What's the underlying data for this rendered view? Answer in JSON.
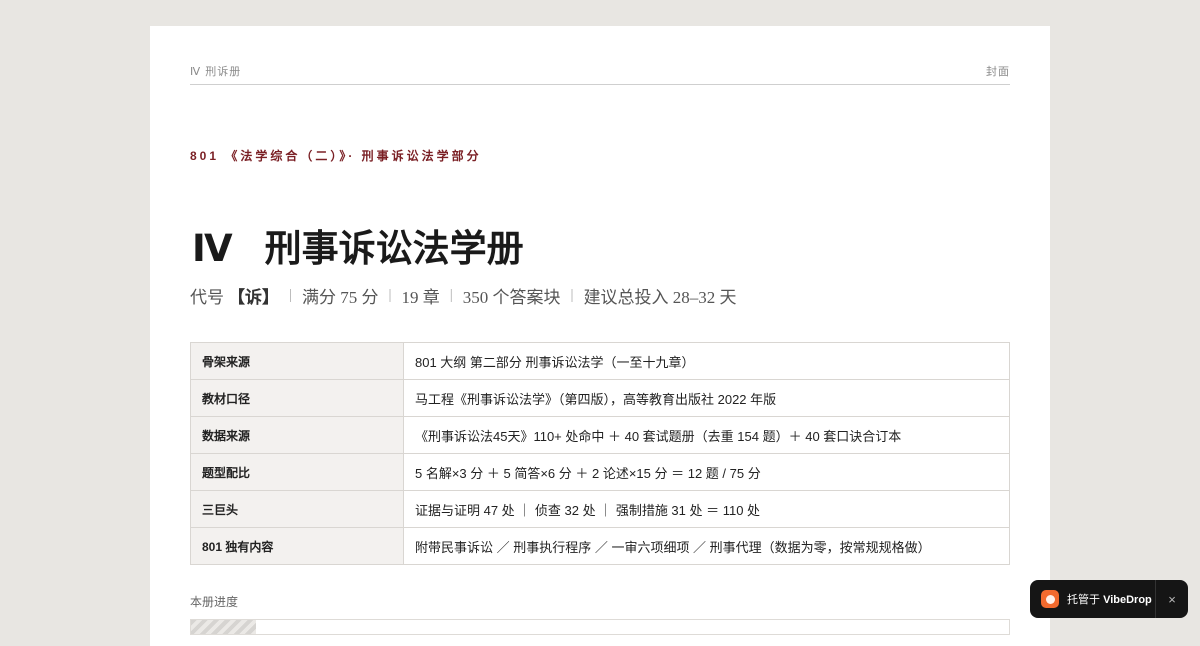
{
  "running_head": {
    "left": "Ⅳ 刑诉册",
    "right": "封面"
  },
  "eyebrow": "801 《法学综合（二）》· 刑事诉讼法学部分",
  "title": {
    "roman": "Ⅳ",
    "name": "刑事诉讼法学册"
  },
  "meta": {
    "code_label": "代号",
    "code_value": "【诉】",
    "separator": "|",
    "items": [
      "满分 75 分",
      "19 章",
      "350 个答案块",
      "建议总投入 28–32 天"
    ]
  },
  "info_table": [
    {
      "key": "骨架来源",
      "value": "801 大纲 第二部分 刑事诉讼法学（一至十九章）"
    },
    {
      "key": "教材口径",
      "value": "马工程《刑事诉讼法学》（第四版），高等教育出版社 2022 年版"
    },
    {
      "key": "数据来源",
      "value": "《刑事诉讼法45天》110+ 处命中 ＋ 40 套试题册（去重 154 题）＋ 40 套口诀合订本"
    },
    {
      "key": "题型配比",
      "value": "5 名解×3 分 ＋ 5 简答×6 分 ＋ 2 论述×15 分 ＝ 12 题 / 75 分"
    },
    {
      "key": "三巨头",
      "value": "证据与证明 47 处 ｜ 侦查 32 处 ｜ 强制措施 31 处 ＝ 110 处"
    },
    {
      "key": "801 独有内容",
      "value": "附带民事诉讼 ／ 刑事执行程序 ／ 一审六项细项 ／ 刑事代理（数据为零，按常规规格做）"
    }
  ],
  "progress": {
    "label": "本册进度",
    "fraction": 0.08
  },
  "toast": {
    "prefix": "托管于",
    "brand": "VibeDrop",
    "close": "×",
    "logo_icon": "vibedrop-logo-icon",
    "accent": "#f26a2e"
  },
  "colors": {
    "eyebrow": "#7a1f24",
    "background": "#e8e6e2",
    "page": "#ffffff"
  }
}
